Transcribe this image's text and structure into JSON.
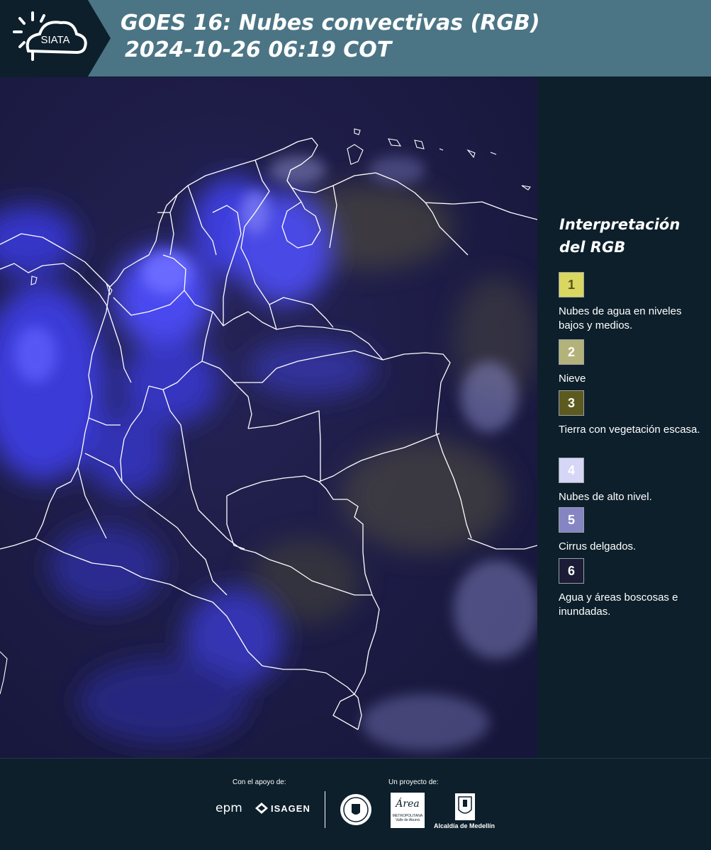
{
  "header": {
    "logo_text": "SIATA",
    "title_line1": "GOES 16: Nubes convectivas (RGB)",
    "title_line2": "2024-10-26 06:19 COT"
  },
  "legend": {
    "title": "Interpretación del RGB",
    "items": [
      {
        "number": "1",
        "label": "Nubes de agua en niveles bajos y medios.",
        "color": "#d9d760",
        "text_color": "#555520"
      },
      {
        "number": "2",
        "label": "Nieve",
        "color": "#b3b27a",
        "text_color": "#ffffff"
      },
      {
        "number": "3",
        "label": "Tierra con vegetación escasa.",
        "color": "#5c5a1e",
        "text_color": "#ffffff"
      },
      {
        "number": "4",
        "label": "Nubes de alto nivel.",
        "color": "#d6d6f6",
        "text_color": "#ffffff"
      },
      {
        "number": "5",
        "label": "Cirrus delgados.",
        "color": "#8585c4",
        "text_color": "#ffffff"
      },
      {
        "number": "6",
        "label": "Agua y áreas boscosas e inundadas.",
        "color": "#1c1c36",
        "text_color": "#ffffff"
      }
    ]
  },
  "footer": {
    "support_label": "Con el apoyo de:",
    "project_label": "Un proyecto de:",
    "sponsors": [
      "epm",
      "ISAGEN"
    ],
    "partners": [
      "METROPOLITANA Valle de Aburrá",
      "Alcaldía de Medellín"
    ],
    "area_logo_text": "Área"
  },
  "colors": {
    "header_bg": "#4b7585",
    "panel_bg": "#0c1f2b",
    "map_bg": "#1a1a3e"
  }
}
